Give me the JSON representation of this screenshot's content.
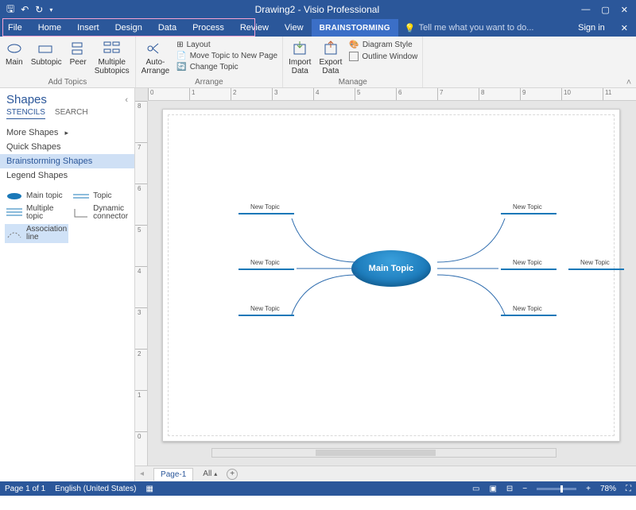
{
  "titlebar": {
    "title": "Drawing2 - Visio Professional"
  },
  "tabs": {
    "file": "File",
    "home": "Home",
    "insert": "Insert",
    "design": "Design",
    "data": "Data",
    "process": "Process",
    "review": "Review",
    "view": "View",
    "brainstorming": "BRAINSTORMING",
    "tellme": "Tell me what you want to do...",
    "signin": "Sign in"
  },
  "ribbon": {
    "addtopics": {
      "label": "Add Topics",
      "main": "Main",
      "subtopic": "Subtopic",
      "peer": "Peer",
      "multiple": "Multiple\nSubtopics"
    },
    "arrange": {
      "label": "Arrange",
      "auto": "Auto-\nArrange",
      "layout": "Layout",
      "move": "Move Topic to New Page",
      "change": "Change Topic"
    },
    "manage": {
      "label": "Manage",
      "import": "Import\nData",
      "export": "Export\nData",
      "style": "Diagram Style",
      "outline": "Outline Window"
    }
  },
  "shapes": {
    "title": "Shapes",
    "tabs": {
      "stencils": "STENCILS",
      "search": "SEARCH"
    },
    "cats": {
      "more": "More Shapes",
      "quick": "Quick Shapes",
      "brain": "Brainstorming Shapes",
      "legend": "Legend Shapes"
    },
    "items": {
      "maintopic": "Main topic",
      "topic": "Topic",
      "multiple": "Multiple\ntopic",
      "dynamic": "Dynamic\nconnector",
      "assoc": "Association\nline"
    }
  },
  "mindmap": {
    "center": "Main Topic",
    "branch": "New Topic"
  },
  "pagetabs": {
    "page1": "Page-1",
    "all": "All"
  },
  "status": {
    "pages": "Page 1 of 1",
    "lang": "English (United States)",
    "zoom": "78%"
  },
  "ruler_h": [
    "0",
    "1",
    "2",
    "3",
    "4",
    "5",
    "6",
    "7",
    "8",
    "9",
    "10",
    "11"
  ],
  "ruler_v": [
    "8",
    "7",
    "6",
    "5",
    "4",
    "3",
    "2",
    "1",
    "0"
  ]
}
